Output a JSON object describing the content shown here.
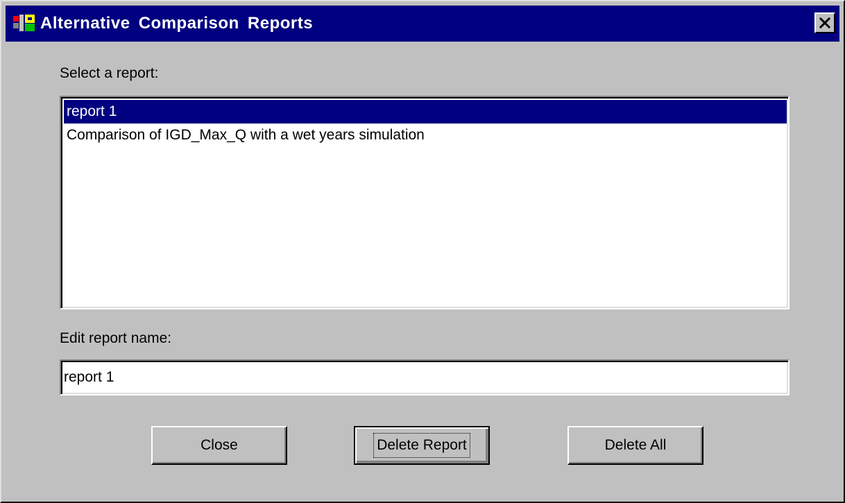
{
  "window": {
    "title": "Alternative Comparison Reports",
    "close_glyph": "✕",
    "app_icon": "app-icon"
  },
  "select_label": "Select a report:",
  "reports": [
    {
      "label": "report 1",
      "selected": true
    },
    {
      "label": "Comparison of IGD_Max_Q with a wet years simulation",
      "selected": false
    }
  ],
  "edit_label": "Edit report name:",
  "edit_value": "report 1",
  "buttons": {
    "close": "Close",
    "delete_report": "Delete Report",
    "delete_all": "Delete All"
  },
  "colors": {
    "titlebar": "#000080",
    "face": "#c0c0c0",
    "selection": "#000080"
  }
}
